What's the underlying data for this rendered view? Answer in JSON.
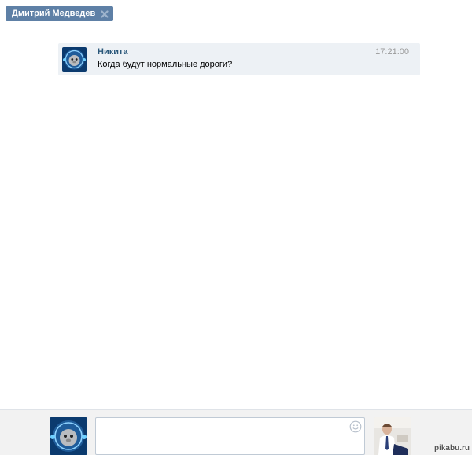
{
  "header": {
    "recipient_name": "Дмитрий Медведев"
  },
  "message": {
    "author": "Никита",
    "time": "17:21:00",
    "text": "Когда будут нормальные дороги?"
  },
  "compose": {
    "input_value": "",
    "input_placeholder": ""
  },
  "watermark": "pikabu.ru",
  "icons": {
    "close": "close-icon",
    "smile": "smile-icon"
  },
  "colors": {
    "accent": "#5e80a6",
    "author_link": "#2b587a",
    "message_bg": "#edf1f5"
  }
}
